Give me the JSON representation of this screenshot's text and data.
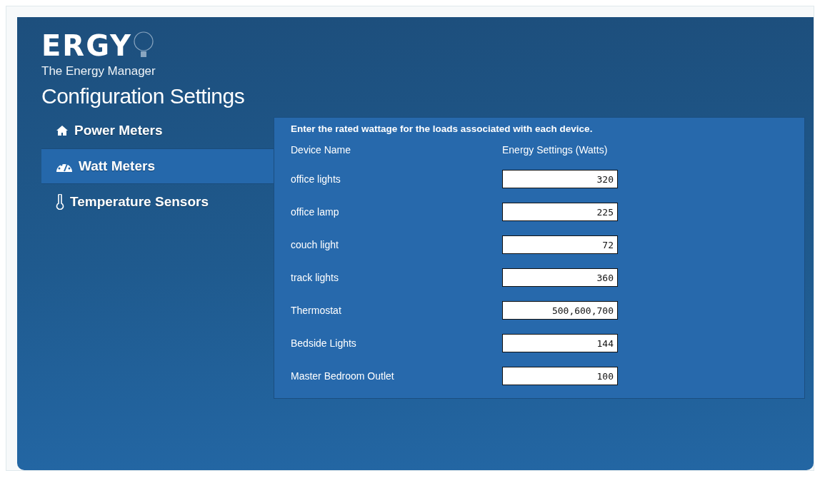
{
  "logo": {
    "wordmark": "ERGY",
    "tagline": "The Energy Manager"
  },
  "title": "Configuration Settings",
  "nav": [
    {
      "label": "Power Meters",
      "selected": false
    },
    {
      "label": "Watt Meters",
      "selected": true
    },
    {
      "label": "Temperature Sensors",
      "selected": false
    }
  ],
  "form": {
    "instructions": "Enter the rated wattage for the loads associated with each device.",
    "columns": [
      "Device Name",
      "Energy Settings (Watts)"
    ],
    "rows": [
      {
        "name": "office lights",
        "value": "320"
      },
      {
        "name": "office lamp",
        "value": "225"
      },
      {
        "name": "couch light",
        "value": "72"
      },
      {
        "name": "track lights",
        "value": "360"
      },
      {
        "name": "Thermostat",
        "value": "500,600,700"
      },
      {
        "name": "Bedside Lights",
        "value": "144"
      },
      {
        "name": "Master Bedroom Outlet",
        "value": "100"
      }
    ]
  }
}
